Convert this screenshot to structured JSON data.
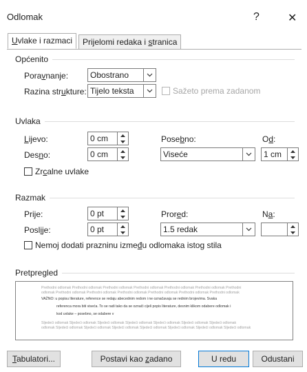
{
  "dialog": {
    "title": "Odlomak",
    "help": "?",
    "close": "✕"
  },
  "tabs": [
    {
      "pre": "",
      "acc": "U",
      "post": "vlake i razmaci"
    },
    {
      "pre": "Prijelomi redaka i ",
      "acc": "s",
      "post": "tranica"
    }
  ],
  "general": {
    "header": "Općenito",
    "alignment": {
      "pre": "Pora",
      "acc": "v",
      "post": "nanje:",
      "value": "Obostrano"
    },
    "outline": {
      "pre": "Razina str",
      "acc": "u",
      "post": "kture:",
      "value": "Tijelo teksta"
    },
    "collapsed_label": "Sažeto prema zadanom"
  },
  "indent": {
    "header": "Uvlaka",
    "left": {
      "pre": "",
      "acc": "L",
      "post": "ijevo:",
      "value": "0 cm"
    },
    "right": {
      "pre": "Des",
      "acc": "n",
      "post": "o:",
      "value": "0 cm"
    },
    "special": {
      "pre": "Pose",
      "acc": "b",
      "post": "no:",
      "value": "Viseće"
    },
    "by": {
      "pre": "O",
      "acc": "d",
      "post": ":",
      "value": "1 cm"
    },
    "mirror": {
      "pre": "Zr",
      "acc": "c",
      "post": "alne uvlake"
    }
  },
  "spacing": {
    "header": "Razmak",
    "before": {
      "pre": "Pri",
      "acc": "j",
      "post": "e:",
      "value": "0 pt"
    },
    "after": {
      "pre": "Posl",
      "acc": "i",
      "post": "je:",
      "value": "0 pt"
    },
    "line": {
      "pre": "Pror",
      "acc": "e",
      "post": "d:",
      "value": "1.5 redak"
    },
    "at": {
      "pre": "N",
      "acc": "a",
      "post": ":",
      "value": ""
    },
    "no_space": {
      "pre": "Nemoj dodati prazninu izme",
      "acc": "đ",
      "post": "u odlomaka istog stila"
    }
  },
  "preview": {
    "header": "Pretpregled",
    "prev1": "Prethodni odlomak Prethodni odlomak Prethodni odlomak Prethodni odlomak Prethodni odlomak Prethodni odlomak Prethodni",
    "prev2": "odlomak Prethodni odlomak Prethodni odlomak Prethodni odlomak Prethodni odlomak Prethodni odlomak Prethodni odlomak",
    "cur1": "VAŽNO: u popisu literature, reference se redaju abecednim redom i ne označavaju se rednim brojevima. Svaka",
    "cur2": "referenca mora biti viseća. To se radi tako da se označi cijeli popis literature, desnim klikom odabere odlomak i",
    "cur3": "kod uvlake – posebno, se odabere v",
    "next1": "Sljedeći odlomak Sljedeći odlomak Sljedeći odlomak Sljedeći odlomak Sljedeći odlomak Sljedeći odlomak Sljedeći odlomak",
    "next2": "odlomak Sljedeći odlomak Sljedeći odlomak Sljedeći odlomak Sljedeći odlomak Sljedeći odlomak Sljedeći odlomak Sljedeći odlomak"
  },
  "buttons": {
    "tabs": {
      "pre": "",
      "acc": "T",
      "post": "abulatori..."
    },
    "default": {
      "pre": "Postavi kao ",
      "acc": "z",
      "post": "adano"
    },
    "ok": "U redu",
    "cancel": "Odustani"
  }
}
